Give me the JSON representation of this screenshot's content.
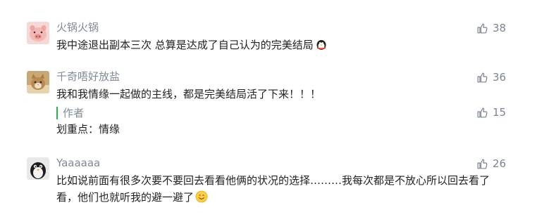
{
  "comments": [
    {
      "nickname": "火锅火锅",
      "text": "我中途退出副本三次 总算是达成了自己认为的完美结局",
      "likes": "38",
      "avatar_icon": "pig-avatar-icon",
      "trailing_emoji": "penguin-emoji-icon"
    },
    {
      "nickname": "千奇唔好放盐",
      "text": "我和我情缘一起做的主线，都是完美结局活了下来！！！",
      "likes": "36",
      "avatar_icon": "cat-avatar-icon",
      "reply": {
        "author_label": "作者",
        "text": "划重点：情缘",
        "likes": "15"
      }
    },
    {
      "nickname": "Yaaaaaa",
      "text": "比如说前面有很多次要不要回去看看他俩的状况的选择………我每次都是不放心所以回去看了看，他们也就听我的避一避了",
      "likes": "26",
      "avatar_icon": "penguin-avatar-icon",
      "trailing_emoji": "smile-emoji-icon"
    }
  ],
  "colors": {
    "author_accent": "#2fb34a",
    "nickname": "#808a9a",
    "body_text": "#222222"
  }
}
